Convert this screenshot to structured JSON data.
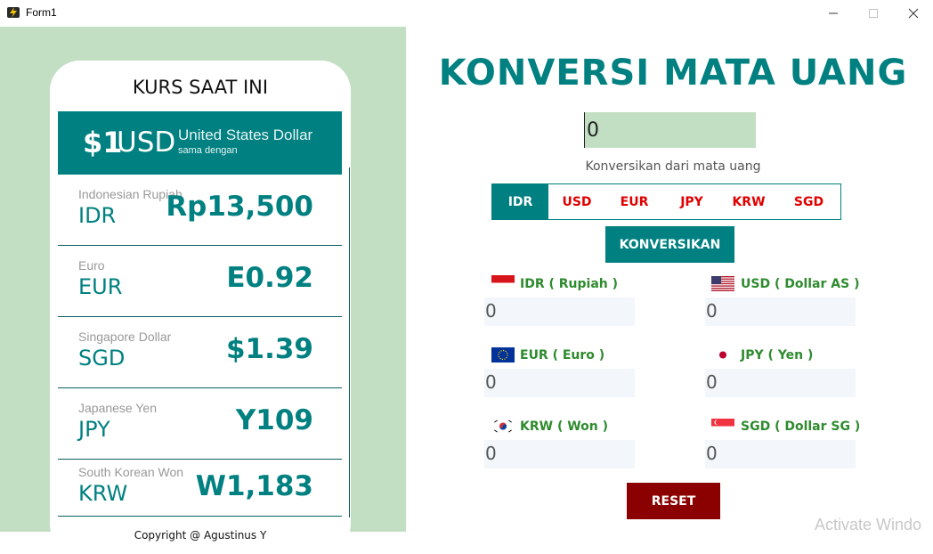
{
  "window": {
    "title": "Form1",
    "icon": "app-lightning-icon",
    "controls": [
      "minimize-icon",
      "maximize-icon",
      "close-icon"
    ]
  },
  "rates_card": {
    "title": "KURS SAAT INI",
    "usd": {
      "amount": "$1",
      "code": "USD",
      "name": "United States Dollar",
      "sub": "sama dengan"
    },
    "rates": [
      {
        "name": "Indonesian Rupiah",
        "code": "IDR",
        "value": "Rp13,500"
      },
      {
        "name": "Euro",
        "code": "EUR",
        "value": "E0.92"
      },
      {
        "name": "Singapore Dollar",
        "code": "SGD",
        "value": "$1.39"
      },
      {
        "name": "Japanese Yen",
        "code": "JPY",
        "value": "Y109"
      },
      {
        "name": "South Korean Won",
        "code": "KRW",
        "value": "W1,183"
      }
    ],
    "copyright": "Copyright @ Agustinus Y"
  },
  "converter": {
    "title": "KONVERSI MATA UANG",
    "amount_value": "0",
    "from_label": "Konversikan dari mata uang",
    "currency_tabs": [
      "IDR",
      "USD",
      "EUR",
      "JPY",
      "KRW",
      "SGD"
    ],
    "selected_tab": "IDR",
    "convert_button": "KONVERSIKAN",
    "results": [
      {
        "label": "IDR ( Rupiah )",
        "value": "0",
        "flag": "indonesia-flag-icon"
      },
      {
        "label": "USD ( Dollar AS )",
        "value": "0",
        "flag": "usa-flag-icon"
      },
      {
        "label": "EUR ( Euro )",
        "value": "0",
        "flag": "eu-flag-icon"
      },
      {
        "label": "JPY ( Yen )",
        "value": "0",
        "flag": "japan-flag-icon"
      },
      {
        "label": "KRW ( Won )",
        "value": "0",
        "flag": "korea-flag-icon"
      },
      {
        "label": "SGD ( Dollar SG )",
        "value": "0",
        "flag": "singapore-flag-icon"
      }
    ],
    "reset_button": "RESET"
  },
  "watermark": "Activate Windo",
  "colors": {
    "accent": "#008080",
    "panel_green": "#c3dfc3",
    "tab_text": "#e00000",
    "result_label": "#2e8b2e",
    "reset": "#8b0000"
  }
}
